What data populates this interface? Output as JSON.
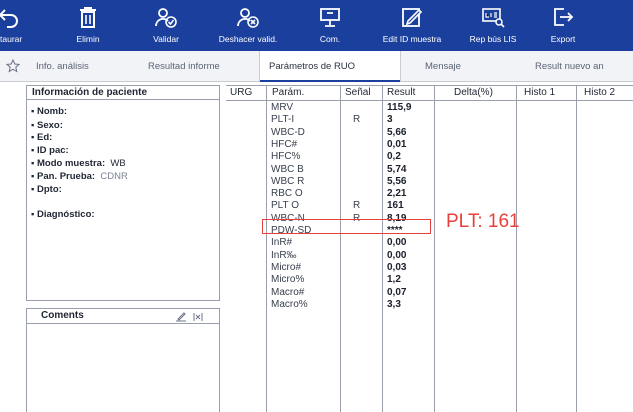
{
  "toolbar": {
    "items": [
      {
        "label": "staurar",
        "icon": "undo-icon"
      },
      {
        "label": "Elimin",
        "icon": "trash-icon"
      },
      {
        "label": "Validar",
        "icon": "validate-user-icon"
      },
      {
        "label": "Deshacer valid.",
        "icon": "unvalidate-user-icon"
      },
      {
        "label": "Com.",
        "icon": "connection-icon"
      },
      {
        "label": "Edit ID muestra",
        "icon": "edit-icon"
      },
      {
        "label": "Rep bús LIS",
        "icon": "lis-search-icon"
      },
      {
        "label": "Export",
        "icon": "export-icon"
      }
    ]
  },
  "tabs": {
    "items": [
      {
        "label": "Info. análisis",
        "active": false
      },
      {
        "label": "Resultad informe",
        "active": false
      },
      {
        "label": "Parámetros de RUO",
        "active": true
      },
      {
        "label": "Mensaje",
        "active": false
      },
      {
        "label": "Result nuevo an",
        "active": false
      }
    ]
  },
  "patient": {
    "title": "Información de paciente",
    "fields": [
      {
        "label": "Nomb:",
        "value": ""
      },
      {
        "label": "Sexo:",
        "value": ""
      },
      {
        "label": "Ed:",
        "value": ""
      },
      {
        "label": "ID pac:",
        "value": ""
      },
      {
        "label": "Modo muestra:",
        "value": "WB"
      },
      {
        "label": "Pan. Prueba:",
        "value": "CDNR"
      },
      {
        "label": "Dpto:",
        "value": ""
      },
      {
        "label": "Diagnóstico:",
        "value": ""
      }
    ]
  },
  "comments": {
    "title": "Coments"
  },
  "table": {
    "columns": [
      "URG",
      "Parám.",
      "Señal",
      "Result",
      "Delta(%)",
      "Histo 1",
      "Histo 2"
    ],
    "rows": [
      {
        "param": "MRV",
        "signal": "",
        "result": "115,9"
      },
      {
        "param": "PLT-I",
        "signal": "R",
        "result": "3"
      },
      {
        "param": "WBC-D",
        "signal": "",
        "result": "5,66"
      },
      {
        "param": "HFC#",
        "signal": "",
        "result": "0,01"
      },
      {
        "param": "HFC%",
        "signal": "",
        "result": "0,2"
      },
      {
        "param": "WBC B",
        "signal": "",
        "result": "5,74"
      },
      {
        "param": "WBC R",
        "signal": "",
        "result": "5,56"
      },
      {
        "param": "RBC O",
        "signal": "",
        "result": "2,21"
      },
      {
        "param": "PLT O",
        "signal": "R",
        "result": "161"
      },
      {
        "param": "WBC-N",
        "signal": "R",
        "result": "8,19"
      },
      {
        "param": "PDW-SD",
        "signal": "",
        "result": "****"
      },
      {
        "param": "InR#",
        "signal": "",
        "result": "0,00"
      },
      {
        "param": "InR‰",
        "signal": "",
        "result": "0,00"
      },
      {
        "param": "Micro#",
        "signal": "",
        "result": "0,03"
      },
      {
        "param": "Micro%",
        "signal": "",
        "result": "1,2"
      },
      {
        "param": "Macro#",
        "signal": "",
        "result": "0,07"
      },
      {
        "param": "Macro%",
        "signal": "",
        "result": "3,3"
      }
    ]
  },
  "annotation": {
    "text": "PLT: 161",
    "color": "#e8403c"
  },
  "colors": {
    "toolbar_bg": "#1b3f9c",
    "highlight": "#e8403c"
  }
}
